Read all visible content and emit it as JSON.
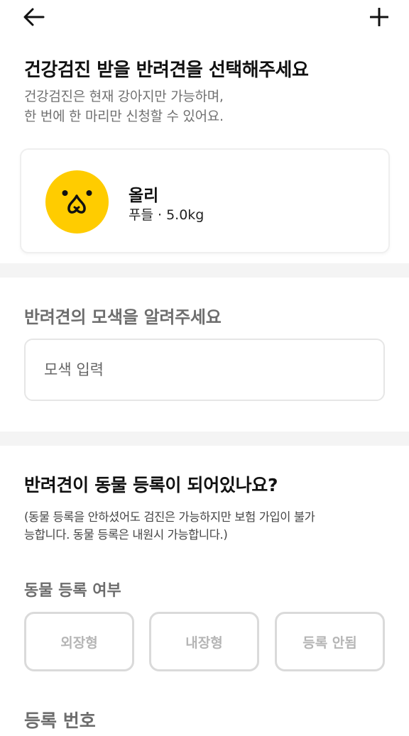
{
  "header": {
    "back_icon": "arrow-left-icon",
    "add_icon": "plus-icon"
  },
  "pet_select": {
    "title": "건강검진 받을 반려견을 선택해주세요",
    "subtitle_lines": [
      "건강검진은 현재 강아지만 가능하며,",
      "한 번에 한 마리만 신청할 수 있어요."
    ],
    "pet": {
      "name": "올리",
      "info": "푸들 · 5.0kg",
      "avatar_icon": "dog-face-icon",
      "avatar_color": "#FFCC00"
    }
  },
  "coat_color": {
    "title": "반려견의 모색을 알려주세요",
    "input_placeholder": "모색 입력",
    "input_value": ""
  },
  "registration": {
    "title": "반려견이 동물 등록이 되어있나요?",
    "notice_lines": [
      "(동물 등록을 안하셨어도 검진은 가능하지만 보험 가입이 불가",
      "능합니다. 동물 등록은 내원시 가능합니다.)"
    ],
    "status_label": "동물 등록 여부",
    "options": [
      "외장형",
      "내장형",
      "등록 안됨"
    ],
    "number_label": "등록 번호"
  },
  "colors": {
    "accent": "#FFCC00",
    "divider": "#F4F4F4",
    "muted_text": "#6D6D6D",
    "option_border": "#DADADA"
  }
}
